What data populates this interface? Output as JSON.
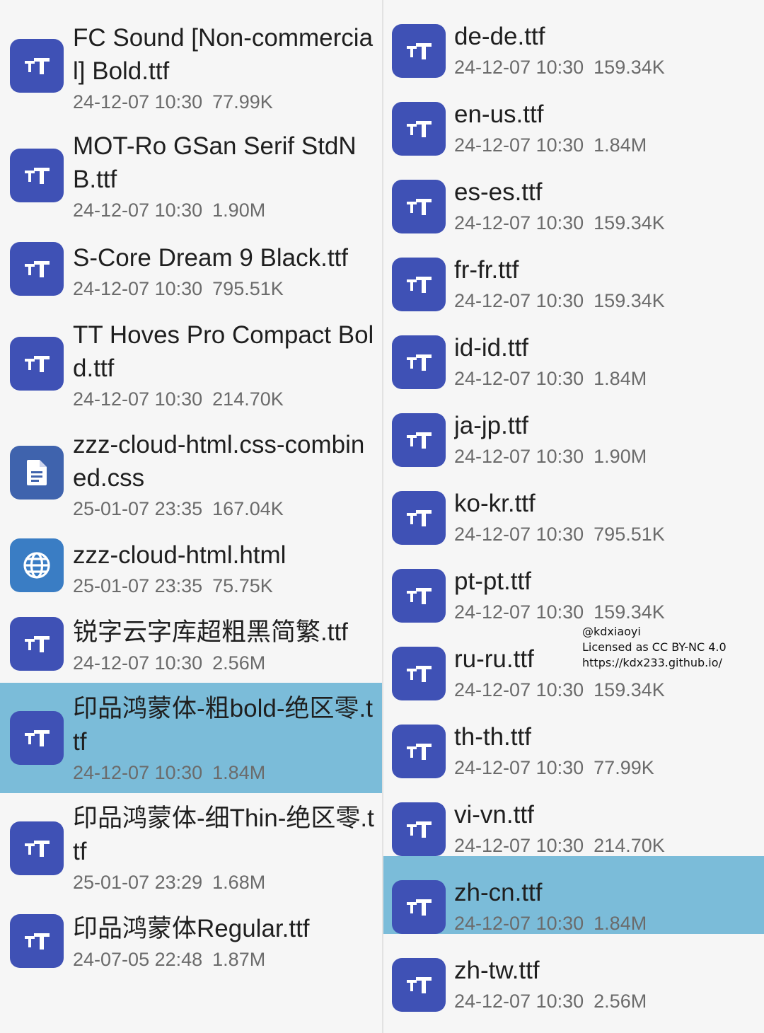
{
  "left_items": [
    {
      "name": "FC Sound [Non-commercial] Bold.ttf",
      "date": "24-12-07 10:30",
      "size": "77.99K",
      "icon": "font-file-icon",
      "selected": false
    },
    {
      "name": "MOT-Ro GSan Serif StdN B.ttf",
      "date": "24-12-07 10:30",
      "size": "1.90M",
      "icon": "font-file-icon",
      "selected": false
    },
    {
      "name": "S-Core Dream 9 Black.ttf",
      "date": "24-12-07 10:30",
      "size": "795.51K",
      "icon": "font-file-icon",
      "selected": false
    },
    {
      "name": "TT Hoves Pro Compact Bold.ttf",
      "date": "24-12-07 10:30",
      "size": "214.70K",
      "icon": "font-file-icon",
      "selected": false
    },
    {
      "name": "zzz-cloud-html.css-combined.css",
      "date": "25-01-07 23:35",
      "size": "167.04K",
      "icon": "document-icon",
      "selected": false
    },
    {
      "name": "zzz-cloud-html.html",
      "date": "25-01-07 23:35",
      "size": "75.75K",
      "icon": "globe-icon",
      "selected": false
    },
    {
      "name": "锐字云字库超粗黑简繁.ttf",
      "date": "24-12-07 10:30",
      "size": "2.56M",
      "icon": "font-file-icon",
      "selected": false
    },
    {
      "name": "印品鸿蒙体-粗bold-绝区零.ttf",
      "date": "24-12-07 10:30",
      "size": "1.84M",
      "icon": "font-file-icon",
      "selected": true
    },
    {
      "name": "印品鸿蒙体-细Thin-绝区零.ttf",
      "date": "25-01-07 23:29",
      "size": "1.68M",
      "icon": "font-file-icon",
      "selected": false
    },
    {
      "name": "印品鸿蒙体Regular.ttf",
      "date": "24-07-05 22:48",
      "size": "1.87M",
      "icon": "font-file-icon",
      "selected": false
    }
  ],
  "right_items": [
    {
      "name": "de-de.ttf",
      "date": "24-12-07 10:30",
      "size": "159.34K",
      "icon": "font-file-icon",
      "selected": false
    },
    {
      "name": "en-us.ttf",
      "date": "24-12-07 10:30",
      "size": "1.84M",
      "icon": "font-file-icon",
      "selected": false
    },
    {
      "name": "es-es.ttf",
      "date": "24-12-07 10:30",
      "size": "159.34K",
      "icon": "font-file-icon",
      "selected": false
    },
    {
      "name": "fr-fr.ttf",
      "date": "24-12-07 10:30",
      "size": "159.34K",
      "icon": "font-file-icon",
      "selected": false
    },
    {
      "name": "id-id.ttf",
      "date": "24-12-07 10:30",
      "size": "1.84M",
      "icon": "font-file-icon",
      "selected": false
    },
    {
      "name": "ja-jp.ttf",
      "date": "24-12-07 10:30",
      "size": "1.90M",
      "icon": "font-file-icon",
      "selected": false
    },
    {
      "name": "ko-kr.ttf",
      "date": "24-12-07 10:30",
      "size": "795.51K",
      "icon": "font-file-icon",
      "selected": false
    },
    {
      "name": "pt-pt.ttf",
      "date": "24-12-07 10:30",
      "size": "159.34K",
      "icon": "font-file-icon",
      "selected": false
    },
    {
      "name": "ru-ru.ttf",
      "date": "24-12-07 10:30",
      "size": "159.34K",
      "icon": "font-file-icon",
      "selected": false
    },
    {
      "name": "th-th.ttf",
      "date": "24-12-07 10:30",
      "size": "77.99K",
      "icon": "font-file-icon",
      "selected": false
    },
    {
      "name": "vi-vn.ttf",
      "date": "24-12-07 10:30",
      "size": "214.70K",
      "icon": "font-file-icon",
      "selected": false
    },
    {
      "name": "zh-cn.ttf",
      "date": "24-12-07 10:30",
      "size": "1.84M",
      "icon": "font-file-icon",
      "selected": true
    },
    {
      "name": "zh-tw.ttf",
      "date": "24-12-07 10:30",
      "size": "2.56M",
      "icon": "font-file-icon",
      "selected": false
    }
  ],
  "watermark": {
    "handle": "@kdxiaoyi",
    "license": "Licensed as CC BY-NC 4.0",
    "url": "https://kdx233.github.io/"
  },
  "colors": {
    "font_icon": "#3f51b5",
    "document_icon": "#3f63ad",
    "globe_icon": "#3a7dc4",
    "selection": "#7bbcd9",
    "background": "#f6f6f6"
  }
}
